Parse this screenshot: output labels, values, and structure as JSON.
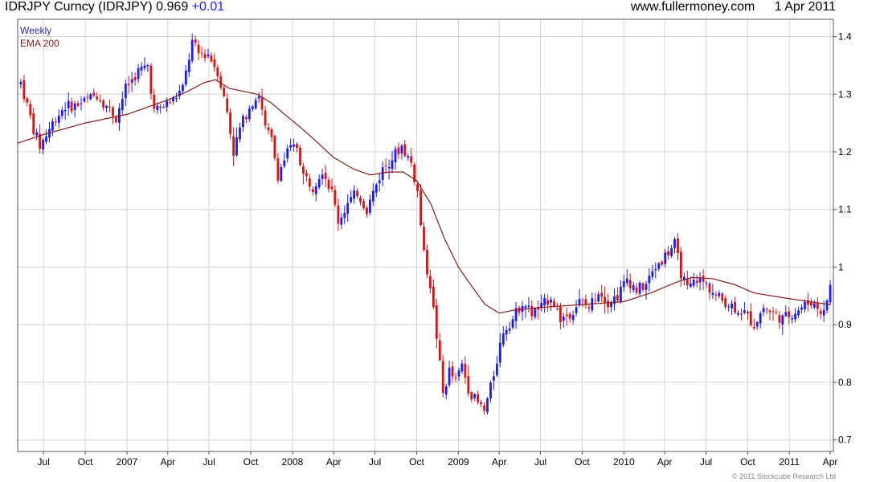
{
  "header": {
    "ticker_line": "IDRJPY Curncy (IDRJPY) 0.969",
    "change": "+0.01",
    "website": "www.fullermoney.com",
    "date": "1 Apr 2011"
  },
  "copyright": "© 2011 Stockcube Research Ltd",
  "chart_data": {
    "type": "candlestick",
    "title": "IDRJPY Curncy (IDRJPY) 0.969 +0.01",
    "legend": [
      {
        "name": "Weekly",
        "color": "#2a2ab8"
      },
      {
        "name": "EMA 200",
        "color": "#8b1a1a"
      }
    ],
    "legend_placement": "top-left",
    "colors": {
      "up": "#1a1aff",
      "down": "#e01010",
      "ema": "#8b1a1a",
      "grid": "#d4d4d4"
    },
    "grid": true,
    "ylim": [
      0.68,
      1.43
    ],
    "yticks": [
      0.7,
      0.8,
      0.9,
      1.0,
      1.1,
      1.2,
      1.3,
      1.4
    ],
    "ytick_labels": [
      "0.7",
      "0.8",
      "0.9",
      "1",
      "1.1",
      "1.2",
      "1.3",
      "1.4"
    ],
    "x_range": [
      "2006-05-05",
      "2011-04-08"
    ],
    "xticks": [
      {
        "date": "2006-07-01",
        "label": "Jul"
      },
      {
        "date": "2006-10-01",
        "label": "Oct"
      },
      {
        "date": "2007-01-01",
        "label": "2007"
      },
      {
        "date": "2007-04-01",
        "label": "Apr"
      },
      {
        "date": "2007-07-01",
        "label": "Jul"
      },
      {
        "date": "2007-10-01",
        "label": "Oct"
      },
      {
        "date": "2008-01-01",
        "label": "2008"
      },
      {
        "date": "2008-04-01",
        "label": "Apr"
      },
      {
        "date": "2008-07-01",
        "label": "Jul"
      },
      {
        "date": "2008-10-01",
        "label": "Oct"
      },
      {
        "date": "2009-01-01",
        "label": "2009"
      },
      {
        "date": "2009-04-01",
        "label": "Apr"
      },
      {
        "date": "2009-07-01",
        "label": "Jul"
      },
      {
        "date": "2009-10-01",
        "label": "Oct"
      },
      {
        "date": "2010-01-01",
        "label": "2010"
      },
      {
        "date": "2010-04-01",
        "label": "Apr"
      },
      {
        "date": "2010-07-01",
        "label": "Jul"
      },
      {
        "date": "2010-10-01",
        "label": "Oct"
      },
      {
        "date": "2011-01-01",
        "label": "2011"
      },
      {
        "date": "2011-04-01",
        "label": "Apr"
      }
    ],
    "price_path": [
      [
        "2006-05-12",
        1.32
      ],
      [
        "2006-05-26",
        1.28
      ],
      [
        "2006-06-09",
        1.24
      ],
      [
        "2006-06-23",
        1.21
      ],
      [
        "2006-07-07",
        1.23
      ],
      [
        "2006-07-28",
        1.26
      ],
      [
        "2006-08-18",
        1.28
      ],
      [
        "2006-09-08",
        1.28
      ],
      [
        "2006-10-06",
        1.29
      ],
      [
        "2006-10-27",
        1.3
      ],
      [
        "2006-11-17",
        1.28
      ],
      [
        "2006-12-08",
        1.26
      ],
      [
        "2006-12-29",
        1.31
      ],
      [
        "2007-01-26",
        1.34
      ],
      [
        "2007-02-16",
        1.35
      ],
      [
        "2007-03-02",
        1.27
      ],
      [
        "2007-03-23",
        1.28
      ],
      [
        "2007-04-13",
        1.29
      ],
      [
        "2007-05-04",
        1.31
      ],
      [
        "2007-05-25",
        1.39
      ],
      [
        "2007-06-08",
        1.37
      ],
      [
        "2007-06-29",
        1.37
      ],
      [
        "2007-07-20",
        1.34
      ],
      [
        "2007-08-10",
        1.27
      ],
      [
        "2007-08-24",
        1.2
      ],
      [
        "2007-09-07",
        1.24
      ],
      [
        "2007-09-28",
        1.28
      ],
      [
        "2007-10-19",
        1.3
      ],
      [
        "2007-11-02",
        1.24
      ],
      [
        "2007-11-16",
        1.22
      ],
      [
        "2007-11-30",
        1.16
      ],
      [
        "2007-12-21",
        1.2
      ],
      [
        "2008-01-11",
        1.21
      ],
      [
        "2008-01-25",
        1.16
      ],
      [
        "2008-02-15",
        1.14
      ],
      [
        "2008-03-07",
        1.17
      ],
      [
        "2008-03-28",
        1.13
      ],
      [
        "2008-04-11",
        1.08
      ],
      [
        "2008-05-02",
        1.11
      ],
      [
        "2008-05-23",
        1.13
      ],
      [
        "2008-06-13",
        1.1
      ],
      [
        "2008-06-27",
        1.13
      ],
      [
        "2008-07-18",
        1.17
      ],
      [
        "2008-08-08",
        1.19
      ],
      [
        "2008-08-29",
        1.21
      ],
      [
        "2008-09-19",
        1.18
      ],
      [
        "2008-10-03",
        1.13
      ],
      [
        "2008-10-17",
        1.02
      ],
      [
        "2008-10-31",
        0.97
      ],
      [
        "2008-11-14",
        0.88
      ],
      [
        "2008-11-28",
        0.78
      ],
      [
        "2008-12-12",
        0.82
      ],
      [
        "2008-12-26",
        0.8
      ],
      [
        "2009-01-09",
        0.83
      ],
      [
        "2009-01-23",
        0.79
      ],
      [
        "2009-02-06",
        0.77
      ],
      [
        "2009-02-27",
        0.75
      ],
      [
        "2009-03-13",
        0.79
      ],
      [
        "2009-03-27",
        0.84
      ],
      [
        "2009-04-10",
        0.89
      ],
      [
        "2009-05-01",
        0.91
      ],
      [
        "2009-05-22",
        0.94
      ],
      [
        "2009-06-12",
        0.92
      ],
      [
        "2009-07-03",
        0.93
      ],
      [
        "2009-07-24",
        0.95
      ],
      [
        "2009-08-14",
        0.91
      ],
      [
        "2009-09-04",
        0.92
      ],
      [
        "2009-09-25",
        0.94
      ],
      [
        "2009-10-16",
        0.93
      ],
      [
        "2009-11-06",
        0.96
      ],
      [
        "2009-11-27",
        0.94
      ],
      [
        "2009-12-18",
        0.95
      ],
      [
        "2010-01-08",
        0.98
      ],
      [
        "2010-01-29",
        0.96
      ],
      [
        "2010-02-19",
        0.97
      ],
      [
        "2010-03-12",
        1.0
      ],
      [
        "2010-04-02",
        1.02
      ],
      [
        "2010-04-23",
        1.04
      ],
      [
        "2010-05-07",
        0.99
      ],
      [
        "2010-05-21",
        0.96
      ],
      [
        "2010-06-11",
        0.98
      ],
      [
        "2010-07-02",
        0.97
      ],
      [
        "2010-07-23",
        0.95
      ],
      [
        "2010-08-13",
        0.94
      ],
      [
        "2010-09-03",
        0.93
      ],
      [
        "2010-09-24",
        0.92
      ],
      [
        "2010-10-15",
        0.9
      ],
      [
        "2010-11-05",
        0.93
      ],
      [
        "2010-11-26",
        0.92
      ],
      [
        "2010-12-17",
        0.91
      ],
      [
        "2011-01-07",
        0.92
      ],
      [
        "2011-01-28",
        0.93
      ],
      [
        "2011-02-18",
        0.94
      ],
      [
        "2011-03-04",
        0.93
      ],
      [
        "2011-03-18",
        0.92
      ],
      [
        "2011-04-01",
        0.969
      ]
    ],
    "ema_200": [
      [
        "2006-05-05",
        1.215
      ],
      [
        "2006-07-01",
        1.23
      ],
      [
        "2006-10-01",
        1.25
      ],
      [
        "2007-01-01",
        1.265
      ],
      [
        "2007-04-01",
        1.29
      ],
      [
        "2007-05-15",
        1.305
      ],
      [
        "2007-06-20",
        1.32
      ],
      [
        "2007-07-15",
        1.325
      ],
      [
        "2007-08-15",
        1.31
      ],
      [
        "2007-09-15",
        1.305
      ],
      [
        "2007-10-15",
        1.3
      ],
      [
        "2007-11-15",
        1.285
      ],
      [
        "2007-12-15",
        1.265
      ],
      [
        "2008-01-15",
        1.245
      ],
      [
        "2008-02-20",
        1.22
      ],
      [
        "2008-04-01",
        1.19
      ],
      [
        "2008-05-15",
        1.17
      ],
      [
        "2008-06-20",
        1.16
      ],
      [
        "2008-08-01",
        1.165
      ],
      [
        "2008-09-01",
        1.165
      ],
      [
        "2008-10-01",
        1.15
      ],
      [
        "2008-11-01",
        1.11
      ],
      [
        "2008-12-01",
        1.05
      ],
      [
        "2009-01-01",
        1.0
      ],
      [
        "2009-02-01",
        0.965
      ],
      [
        "2009-03-01",
        0.935
      ],
      [
        "2009-04-01",
        0.92
      ],
      [
        "2009-05-01",
        0.925
      ],
      [
        "2009-07-01",
        0.93
      ],
      [
        "2009-10-01",
        0.935
      ],
      [
        "2010-01-01",
        0.94
      ],
      [
        "2010-03-01",
        0.955
      ],
      [
        "2010-05-01",
        0.975
      ],
      [
        "2010-06-01",
        0.982
      ],
      [
        "2010-07-15",
        0.98
      ],
      [
        "2010-09-01",
        0.97
      ],
      [
        "2010-10-15",
        0.955
      ],
      [
        "2011-01-01",
        0.945
      ],
      [
        "2011-04-01",
        0.935
      ]
    ]
  }
}
